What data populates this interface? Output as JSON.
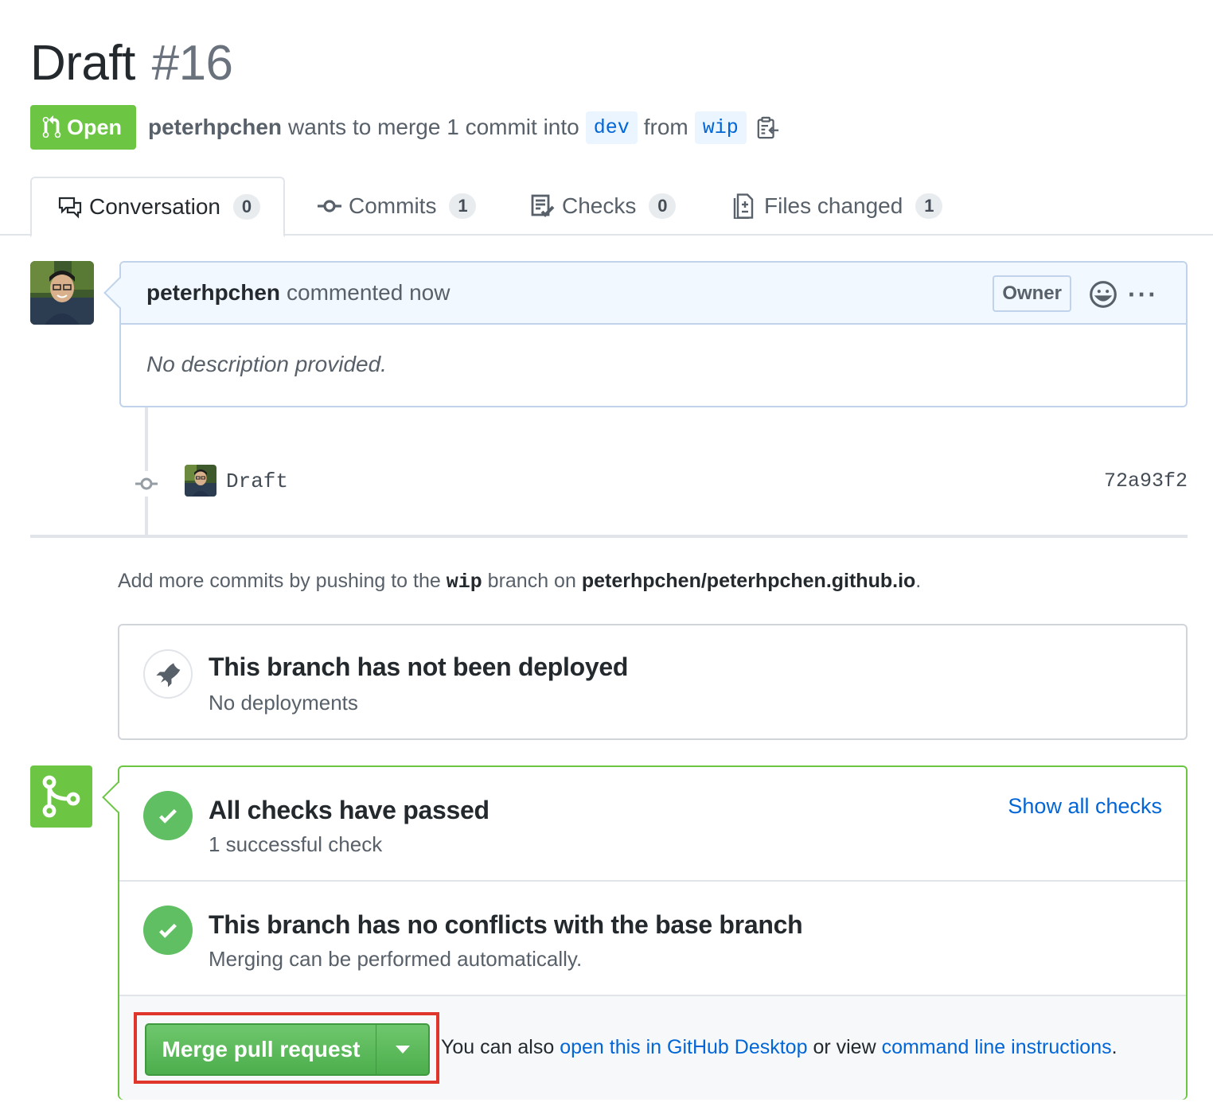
{
  "pr": {
    "title": "Draft",
    "number": "#16",
    "state": "Open",
    "author": "peterhpchen",
    "merge_text": "wants to merge 1 commit into",
    "base_branch": "dev",
    "from_text": "from",
    "head_branch": "wip"
  },
  "tabs": [
    {
      "label": "Conversation",
      "count": "0",
      "icon": "comment-discussion-icon"
    },
    {
      "label": "Commits",
      "count": "1",
      "icon": "git-commit-icon"
    },
    {
      "label": "Checks",
      "count": "0",
      "icon": "checklist-icon"
    },
    {
      "label": "Files changed",
      "count": "1",
      "icon": "diff-icon"
    }
  ],
  "comment": {
    "author": "peterhpchen",
    "action": "commented now",
    "role_label": "Owner",
    "body": "No description provided."
  },
  "commit": {
    "message": "Draft",
    "sha": "72a93f2"
  },
  "hint": {
    "prefix": "Add more commits by pushing to the",
    "branch": "wip",
    "middle": "branch on",
    "repo": "peterhpchen/peterhpchen.github.io",
    "suffix": "."
  },
  "deploy": {
    "title": "This branch has not been deployed",
    "subtitle": "No deployments"
  },
  "checks": {
    "title": "All checks have passed",
    "subtitle": "1 successful check",
    "show_all": "Show all checks"
  },
  "conflicts": {
    "title": "This branch has no conflicts with the base branch",
    "subtitle": "Merging can be performed automatically."
  },
  "merge": {
    "button_label": "Merge pull request",
    "note_prefix": "You can also",
    "desktop_link": "open this in GitHub Desktop",
    "note_middle": "or view",
    "cli_link": "command line instructions",
    "note_suffix": "."
  },
  "colors": {
    "open_green": "#6cc644",
    "link_blue": "#0366d6",
    "highlight_red": "#e0352b"
  }
}
